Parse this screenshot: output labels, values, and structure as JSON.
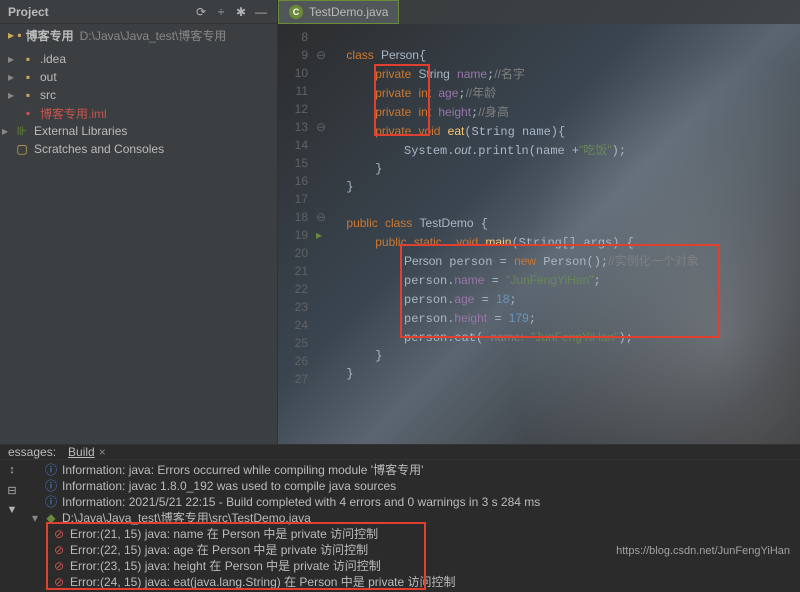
{
  "sidebar": {
    "title": "Project",
    "crumb_project": "博客专用",
    "crumb_path": "D:\\Java\\Java_test\\博客专用",
    "tree": {
      "idea": ".idea",
      "out": "out",
      "src": "src",
      "iml": "博客专用.iml",
      "ext": "External Libraries",
      "scratch": "Scratches and Consoles"
    }
  },
  "tab": {
    "label": "TestDemo.java"
  },
  "gutter": [
    "8",
    "9",
    "10",
    "11",
    "12",
    "13",
    "14",
    "15",
    "16",
    "17",
    "18",
    "19",
    "20",
    "21",
    "22",
    "23",
    "24",
    "25",
    "26",
    "27"
  ],
  "code": {
    "l9_cmt": "//名字",
    "l11_cmt": "//年龄",
    "l12_cmt": "//身高",
    "l14_str": "\"吃饭\"",
    "l20_cmt": "//实例化一个对象",
    "l21_str": "\"JunFengYiHan\"",
    "l22_num": "18",
    "l23_num": "179",
    "l24_str": "\"JunFengYiHan\""
  },
  "messages": {
    "title": "essages:",
    "tab": "Build",
    "info1": "Information: java: Errors occurred while compiling module '博客专用'",
    "info2": "Information: javac 1.8.0_192 was used to compile java sources",
    "info3": "Information: 2021/5/21 22:15 - Build completed with 4 errors and 0 warnings in 3 s 284 ms",
    "file": "D:\\Java\\Java_test\\博客专用\\src\\TestDemo.java",
    "err1": "Error:(21, 15)  java: name 在 Person 中是 private 访问控制",
    "err2": "Error:(22, 15)  java: age 在 Person 中是 private 访问控制",
    "err3": "Error:(23, 15)  java: height 在 Person 中是 private 访问控制",
    "err4": "Error:(24, 15)  java: eat(java.lang.String) 在 Person 中是 private 访问控制"
  },
  "watermark": "https://blog.csdn.net/JunFengYiHan"
}
